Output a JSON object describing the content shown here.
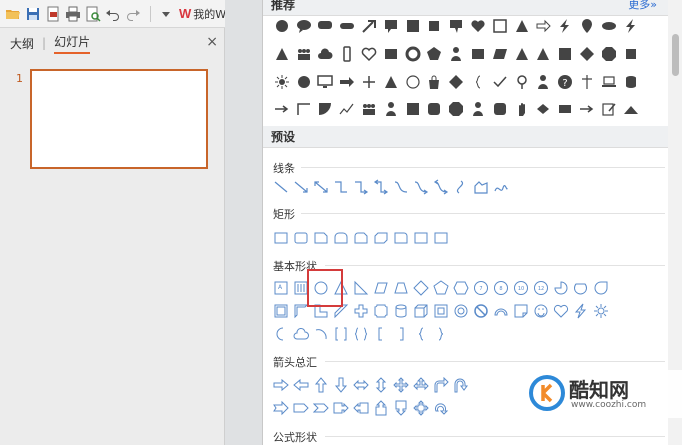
{
  "toolbar": {
    "icons": [
      "open-icon",
      "save-icon",
      "export-pdf-icon",
      "print-icon",
      "print-preview-icon",
      "undo-icon",
      "redo-icon",
      "dropdown-icon"
    ],
    "my_wps_label": "我的WPS",
    "wps_logo_text": "W"
  },
  "left_panel": {
    "tab_outline": "大纲",
    "tab_slides": "幻灯片",
    "close_glyph": "×",
    "slide_number": "1"
  },
  "shapes_panel": {
    "recommended_label": "推荐",
    "more_label": "更多»",
    "preset_label": "预设",
    "sections": {
      "lines": "线条",
      "rectangles": "矩形",
      "basic_shapes": "基本形状",
      "block_arrows": "箭头总汇",
      "equation_shapes": "公式形状"
    }
  },
  "watermark": {
    "title": "酷知网",
    "url": "www.coozhi.com"
  },
  "colors": {
    "accent": "#c8652a",
    "highlight": "#d43b3b",
    "shape_fill": "#444444",
    "outline": "#5b8bc9"
  }
}
